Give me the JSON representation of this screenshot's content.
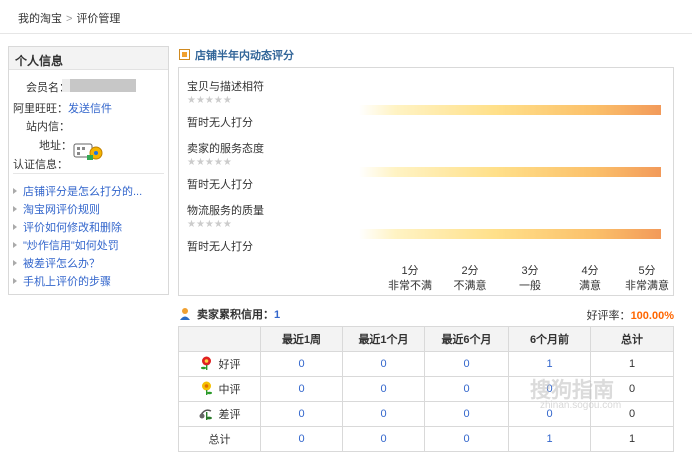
{
  "breadcrumb": {
    "home": "我的淘宝",
    "sep": ">",
    "current": "评价管理"
  },
  "sidebar": {
    "title": "个人信息",
    "member_label": "会员名：",
    "wangwang_label": "阿里旺旺：",
    "wangwang_link": "发送信件",
    "station_label": "站内信：",
    "address_label": "地址：",
    "cert_label": "认证信息：",
    "links": [
      "店铺评分是怎么打分的...",
      "淘宝网评价规则",
      "评价如何修改和删除",
      "\"炒作信用\"如何处罚",
      "被差评怎么办？",
      "手机上评价的步骤"
    ]
  },
  "score_section": {
    "title": "店铺半年内动态评分",
    "items": [
      {
        "name": "宝贝与描述相符",
        "stars": "★★★★★",
        "status": "暂时无人打分"
      },
      {
        "name": "卖家的服务态度",
        "stars": "★★★★★",
        "status": "暂时无人打分"
      },
      {
        "name": "物流服务的质量",
        "stars": "★★★★★",
        "status": "暂时无人打分"
      }
    ],
    "scale": [
      {
        "score": "1分",
        "desc": "非常不满"
      },
      {
        "score": "2分",
        "desc": "不满意"
      },
      {
        "score": "3分",
        "desc": "一般"
      },
      {
        "score": "4分",
        "desc": "满意"
      },
      {
        "score": "5分",
        "desc": "非常满意"
      }
    ]
  },
  "credit": {
    "label": "卖家累积信用：",
    "value": "1",
    "rate_label": "好评率：",
    "rate_value": "100.00%"
  },
  "table": {
    "headers": [
      "",
      "最近1周",
      "最近1个月",
      "最近6个月",
      "6个月前",
      "总计"
    ],
    "rows": [
      {
        "label": "好评",
        "icon": "flower-red-icon",
        "values": [
          "0",
          "0",
          "0",
          "1",
          "1"
        ]
      },
      {
        "label": "中评",
        "icon": "flower-yellow-icon",
        "values": [
          "0",
          "0",
          "0",
          "0",
          "0"
        ]
      },
      {
        "label": "差评",
        "icon": "wilted-flower-icon",
        "values": [
          "0",
          "0",
          "0",
          "0",
          "0"
        ]
      },
      {
        "label": "总计",
        "icon": "",
        "values": [
          "0",
          "0",
          "0",
          "1",
          "1"
        ]
      }
    ]
  },
  "watermark": {
    "text": "搜狗指南",
    "sub": "zhinan.sogou.com"
  },
  "colors": {
    "link": "#3366cc",
    "rate": "#ff6600",
    "bar_end": "#f29a5a"
  }
}
